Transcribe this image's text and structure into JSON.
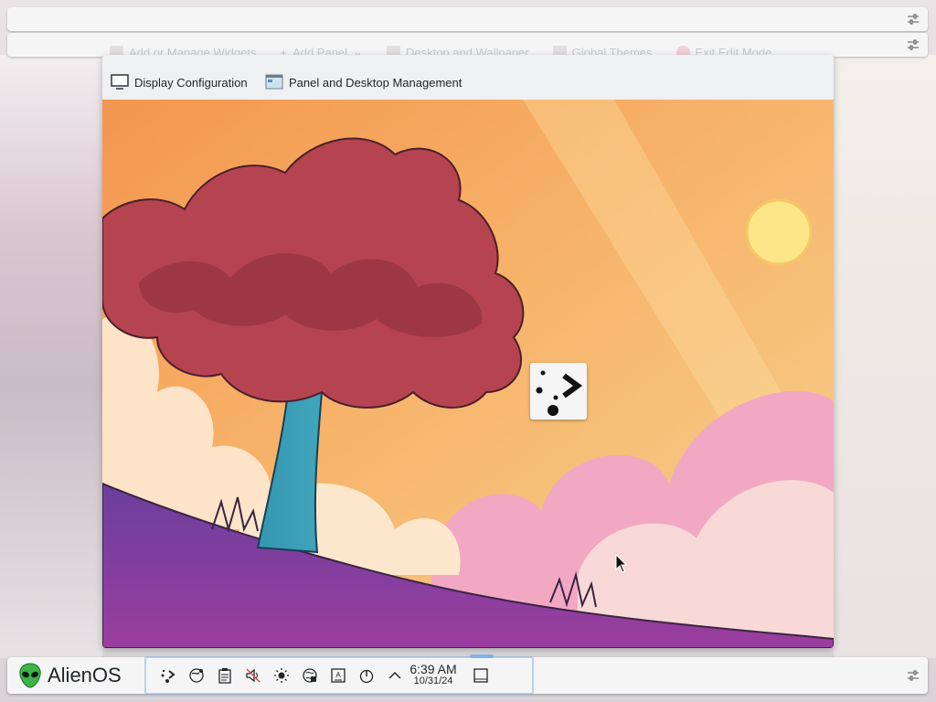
{
  "top_toolbar_ghost": {
    "items": [
      {
        "label": "Add or Manage Widgets"
      },
      {
        "label": "Add Panel"
      },
      {
        "label": "Desktop and Wallpaper"
      },
      {
        "label": "Global Themes"
      },
      {
        "label": "Exit Edit Mode"
      }
    ]
  },
  "desktop_toolbar": {
    "display_config_label": "Display Configuration",
    "panel_mgmt_label": "Panel and Desktop Management"
  },
  "taskbar": {
    "launcher_label": "AlienOS",
    "tray_icons": [
      "kde-connect-icon",
      "network-icon",
      "clipboard-icon",
      "volume-muted-icon",
      "brightness-icon",
      "browser-icon",
      "keyboard-layout-icon",
      "power-icon",
      "show-hidden-chevron-icon"
    ],
    "clock": {
      "time": "6:39 AM",
      "date": "10/31/24"
    }
  },
  "colors": {
    "accent": "#3daee9",
    "panel_bg": "#f6f6f7",
    "toolbar_bg": "#eff0f1"
  }
}
